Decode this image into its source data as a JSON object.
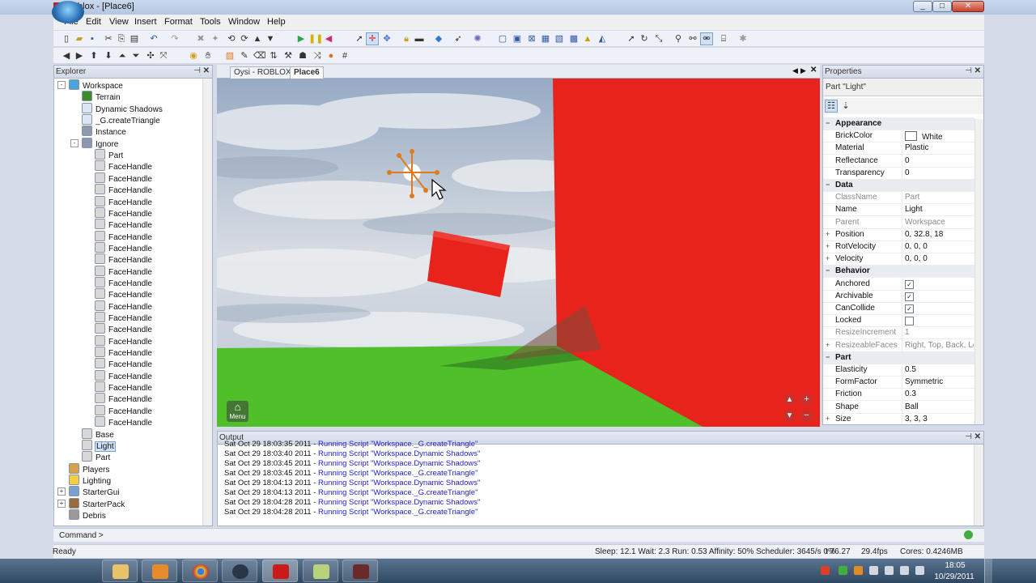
{
  "window": {
    "title": "Roblox - [Place6]",
    "app_icon": "R",
    "min": "_",
    "max": "□",
    "close": "✕"
  },
  "menu": [
    "File",
    "Edit",
    "View",
    "Insert",
    "Format",
    "Tools",
    "Window",
    "Help"
  ],
  "explorer": {
    "title": "Explorer",
    "items": [
      {
        "label": "Workspace",
        "depth": 0,
        "icon": "workspace-icon",
        "expander": "-"
      },
      {
        "label": "Terrain",
        "depth": 1,
        "icon": "terrain-icon"
      },
      {
        "label": "Dynamic Shadows",
        "depth": 1,
        "icon": "script-icon"
      },
      {
        "label": "_G.createTriangle",
        "depth": 1,
        "icon": "script-icon"
      },
      {
        "label": "Instance",
        "depth": 1,
        "icon": "model-icon"
      },
      {
        "label": "Ignore",
        "depth": 1,
        "icon": "model-icon",
        "expander": "-"
      },
      {
        "label": "Part",
        "depth": 2,
        "icon": "part-icon"
      },
      {
        "label": "FaceHandle",
        "depth": 2,
        "icon": "part-icon"
      },
      {
        "label": "FaceHandle",
        "depth": 2,
        "icon": "part-icon"
      },
      {
        "label": "FaceHandle",
        "depth": 2,
        "icon": "part-icon"
      },
      {
        "label": "FaceHandle",
        "depth": 2,
        "icon": "part-icon"
      },
      {
        "label": "FaceHandle",
        "depth": 2,
        "icon": "part-icon"
      },
      {
        "label": "FaceHandle",
        "depth": 2,
        "icon": "part-icon"
      },
      {
        "label": "FaceHandle",
        "depth": 2,
        "icon": "part-icon"
      },
      {
        "label": "FaceHandle",
        "depth": 2,
        "icon": "part-icon"
      },
      {
        "label": "FaceHandle",
        "depth": 2,
        "icon": "part-icon"
      },
      {
        "label": "FaceHandle",
        "depth": 2,
        "icon": "part-icon"
      },
      {
        "label": "FaceHandle",
        "depth": 2,
        "icon": "part-icon"
      },
      {
        "label": "FaceHandle",
        "depth": 2,
        "icon": "part-icon"
      },
      {
        "label": "FaceHandle",
        "depth": 2,
        "icon": "part-icon"
      },
      {
        "label": "FaceHandle",
        "depth": 2,
        "icon": "part-icon"
      },
      {
        "label": "FaceHandle",
        "depth": 2,
        "icon": "part-icon"
      },
      {
        "label": "FaceHandle",
        "depth": 2,
        "icon": "part-icon"
      },
      {
        "label": "FaceHandle",
        "depth": 2,
        "icon": "part-icon"
      },
      {
        "label": "FaceHandle",
        "depth": 2,
        "icon": "part-icon"
      },
      {
        "label": "FaceHandle",
        "depth": 2,
        "icon": "part-icon"
      },
      {
        "label": "FaceHandle",
        "depth": 2,
        "icon": "part-icon"
      },
      {
        "label": "FaceHandle",
        "depth": 2,
        "icon": "part-icon"
      },
      {
        "label": "FaceHandle",
        "depth": 2,
        "icon": "part-icon"
      },
      {
        "label": "FaceHandle",
        "depth": 2,
        "icon": "part-icon"
      },
      {
        "label": "Base",
        "depth": 1,
        "icon": "part-icon"
      },
      {
        "label": "Light",
        "depth": 1,
        "icon": "part-icon",
        "selected": true
      },
      {
        "label": "Part",
        "depth": 1,
        "icon": "part-icon"
      },
      {
        "label": "Players",
        "depth": 0,
        "icon": "players-icon"
      },
      {
        "label": "Lighting",
        "depth": 0,
        "icon": "lighting-icon"
      },
      {
        "label": "StarterGui",
        "depth": 0,
        "icon": "startergui-icon",
        "expander": "+"
      },
      {
        "label": "StarterPack",
        "depth": 0,
        "icon": "starterpack-icon",
        "expander": "+"
      },
      {
        "label": "Debris",
        "depth": 0,
        "icon": "debris-icon"
      }
    ]
  },
  "tabs": [
    {
      "label": "Oysi - ROBLOX",
      "active": false
    },
    {
      "label": "Place6",
      "active": true
    }
  ],
  "viewport": {
    "menu_label": "Menu",
    "zoom_in": "+",
    "zoom_out": "−",
    "tilt_up": "▴",
    "tilt_down": "▾",
    "colors": {
      "part_red": "#e8231c",
      "ground_green": "#4fbf2a",
      "sky": "#b9c8da"
    }
  },
  "properties": {
    "title": "Properties",
    "subtitle": "Part \"Light\"",
    "rows": [
      {
        "cat": true,
        "name": "Appearance"
      },
      {
        "name": "BrickColor",
        "value": "White",
        "swatch": true
      },
      {
        "name": "Material",
        "value": "Plastic"
      },
      {
        "name": "Reflectance",
        "value": "0"
      },
      {
        "name": "Transparency",
        "value": "0"
      },
      {
        "cat": true,
        "name": "Data"
      },
      {
        "name": "ClassName",
        "value": "Part",
        "dim": true
      },
      {
        "name": "Name",
        "value": "Light"
      },
      {
        "name": "Parent",
        "value": "Workspace",
        "dim": true
      },
      {
        "name": "Position",
        "value": "0, 32.8, 18",
        "expander": "+"
      },
      {
        "name": "RotVelocity",
        "value": "0, 0, 0",
        "expander": "+"
      },
      {
        "name": "Velocity",
        "value": "0, 0, 0",
        "expander": "+"
      },
      {
        "cat": true,
        "name": "Behavior"
      },
      {
        "name": "Anchored",
        "check": true
      },
      {
        "name": "Archivable",
        "check": true
      },
      {
        "name": "CanCollide",
        "check": true
      },
      {
        "name": "Locked",
        "check": false
      },
      {
        "name": "ResizeIncrement",
        "value": "1",
        "dim": true
      },
      {
        "name": "ResizeableFaces",
        "value": "Right, Top, Back, Le",
        "dim": true,
        "expander": "+"
      },
      {
        "cat": true,
        "name": "Part"
      },
      {
        "name": "Elasticity",
        "value": "0.5"
      },
      {
        "name": "FormFactor",
        "value": "Symmetric"
      },
      {
        "name": "Friction",
        "value": "0.3"
      },
      {
        "name": "Shape",
        "value": "Ball"
      },
      {
        "name": "Size",
        "value": "3, 3, 3",
        "expander": "+"
      }
    ]
  },
  "output": {
    "title": "Output",
    "lines": [
      {
        "ts": "Sat Oct 29 18:03:35 2011 - ",
        "msg": "Running Script \"Workspace._G.createTriangle\""
      },
      {
        "ts": "Sat Oct 29 18:03:40 2011 - ",
        "msg": "Running Script \"Workspace.Dynamic Shadows\""
      },
      {
        "ts": "Sat Oct 29 18:03:45 2011 - ",
        "msg": "Running Script \"Workspace.Dynamic Shadows\""
      },
      {
        "ts": "Sat Oct 29 18:03:45 2011 - ",
        "msg": "Running Script \"Workspace._G.createTriangle\""
      },
      {
        "ts": "Sat Oct 29 18:04:13 2011 - ",
        "msg": "Running Script \"Workspace.Dynamic Shadows\""
      },
      {
        "ts": "Sat Oct 29 18:04:13 2011 - ",
        "msg": "Running Script \"Workspace._G.createTriangle\""
      },
      {
        "ts": "Sat Oct 29 18:04:28 2011 - ",
        "msg": "Running Script \"Workspace.Dynamic Shadows\""
      },
      {
        "ts": "Sat Oct 29 18:04:28 2011 - ",
        "msg": "Running Script \"Workspace._G.createTriangle\""
      }
    ]
  },
  "command": {
    "label": "Command >",
    "value": ""
  },
  "status": {
    "left": "Ready",
    "stats": "Sleep: 12.1 Wait: 2.3 Run: 0.53 Affinity: 50% Scheduler: 3645/s 0%",
    "t": "t 76.27",
    "fps": "29.4fps",
    "cores": "Cores: 0.4",
    "mem": "246MB"
  },
  "taskbar": {
    "time": "18:05",
    "date": "10/29/2011"
  }
}
